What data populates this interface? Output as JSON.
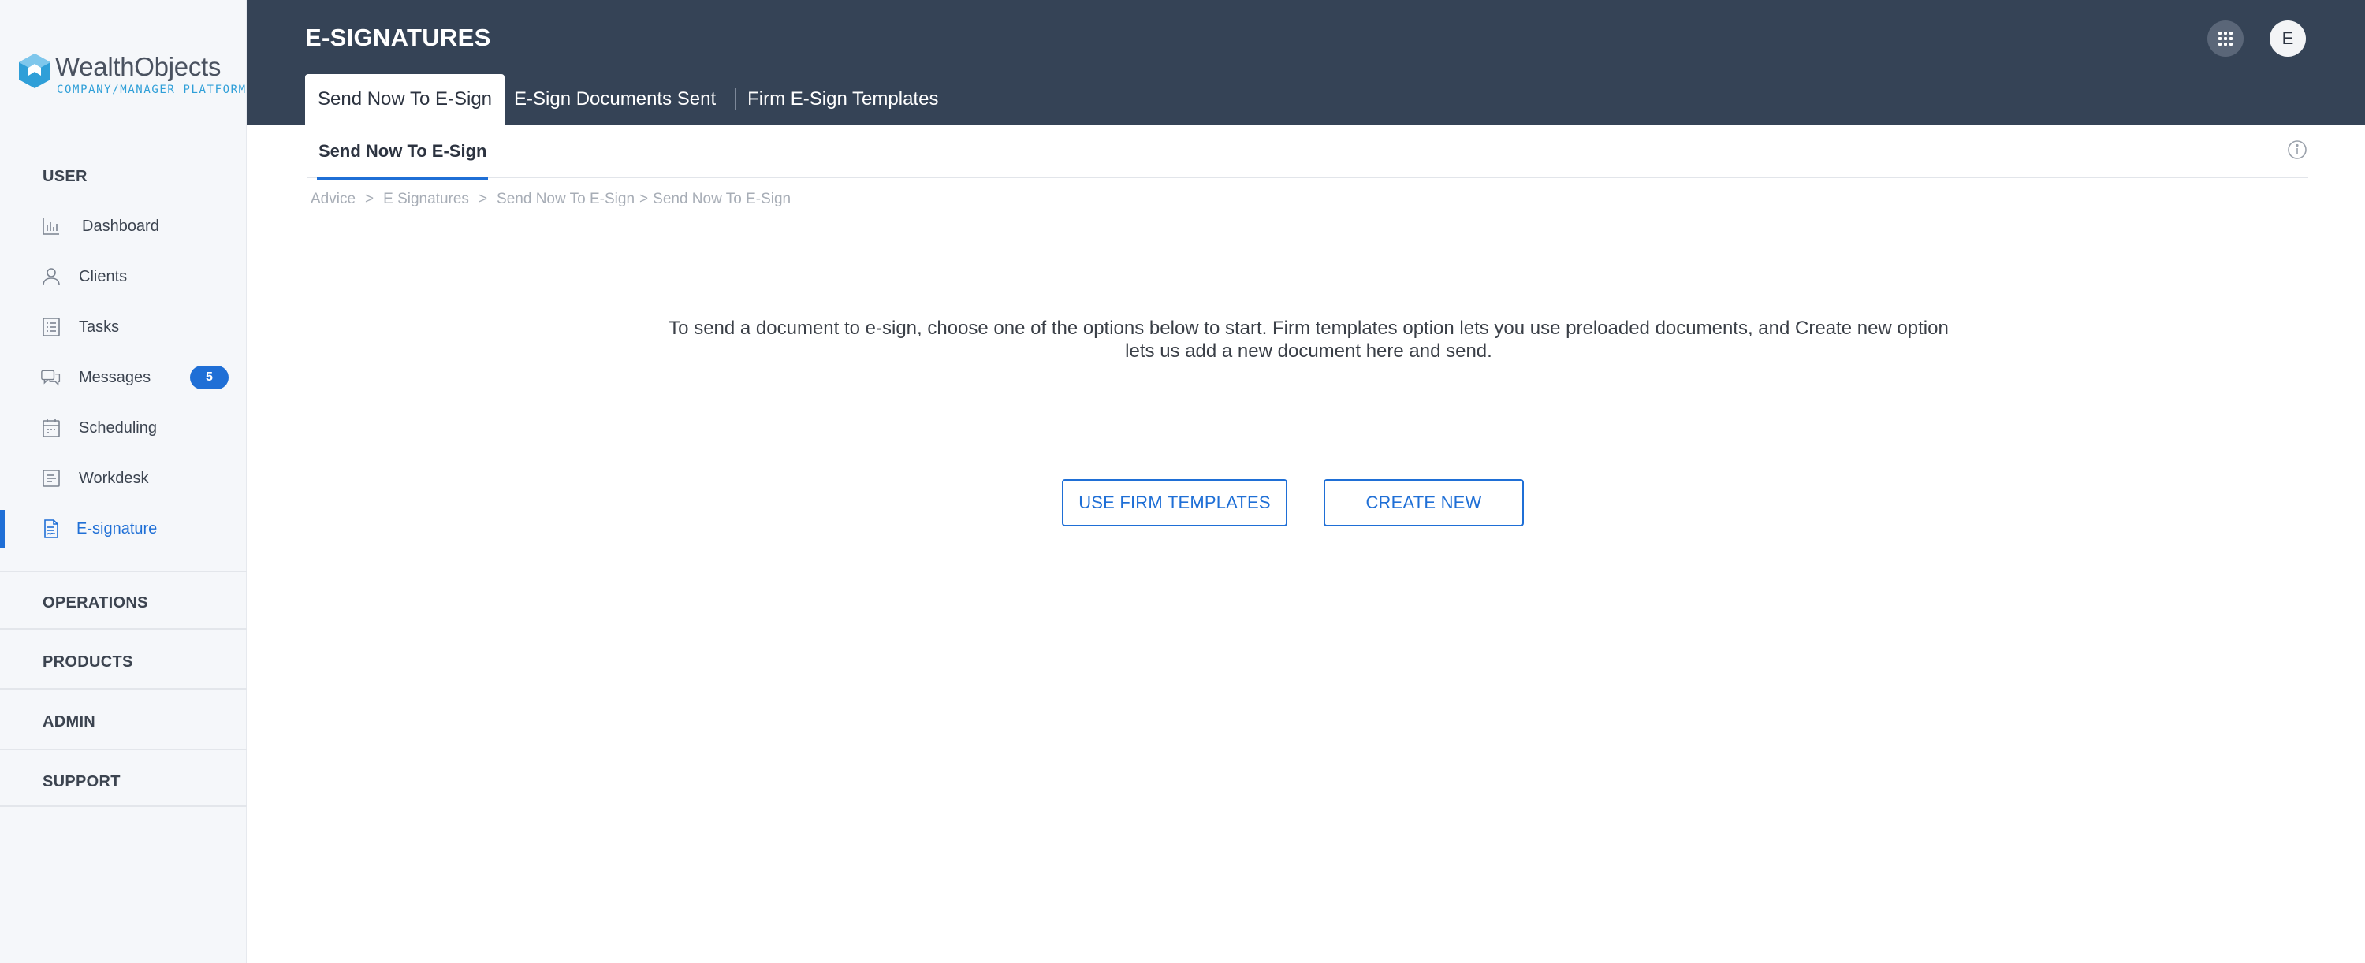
{
  "brand": {
    "name": "WealthObjects",
    "tagline": "COMPANY/MANAGER PLATFORM"
  },
  "colors": {
    "header": "#354356",
    "accent": "#1f6fd6",
    "sidebar": "#f5f7fa",
    "logo_accent": "#2f9fd8"
  },
  "sidebar": {
    "user_section": "USER",
    "items": [
      {
        "label": "Dashboard",
        "icon": "bar-chart-icon"
      },
      {
        "label": "Clients",
        "icon": "person-icon"
      },
      {
        "label": "Tasks",
        "icon": "checklist-icon"
      },
      {
        "label": "Messages",
        "icon": "chat-bubbles-icon",
        "badge": "5"
      },
      {
        "label": "Scheduling",
        "icon": "calendar-icon"
      },
      {
        "label": "Workdesk",
        "icon": "document-icon"
      },
      {
        "label": "E-signature",
        "icon": "signature-document-icon",
        "active": true
      }
    ],
    "sections": [
      "OPERATIONS",
      "PRODUCTS",
      "ADMIN",
      "SUPPORT"
    ]
  },
  "header": {
    "title": "E-SIGNATURES",
    "tabs": [
      {
        "label": "Send Now To E-Sign",
        "active": true
      },
      {
        "label": "E-Sign Documents Sent"
      },
      {
        "label": "Firm E-Sign Templates"
      }
    ],
    "user_initial": "E"
  },
  "subtabs": {
    "active": "Send Now To E-Sign"
  },
  "breadcrumb": [
    "Advice",
    "E Signatures",
    "Send Now To E-Sign",
    "Send Now To E-Sign"
  ],
  "main": {
    "message_line1": "To send a document to e-sign, choose one of the options below to start. Firm templates option lets you use preloaded documents, and Create new option",
    "message_line2": "lets us add a new document here and send.",
    "btn_templates": "USE FIRM TEMPLATES",
    "btn_create": "CREATE NEW"
  }
}
